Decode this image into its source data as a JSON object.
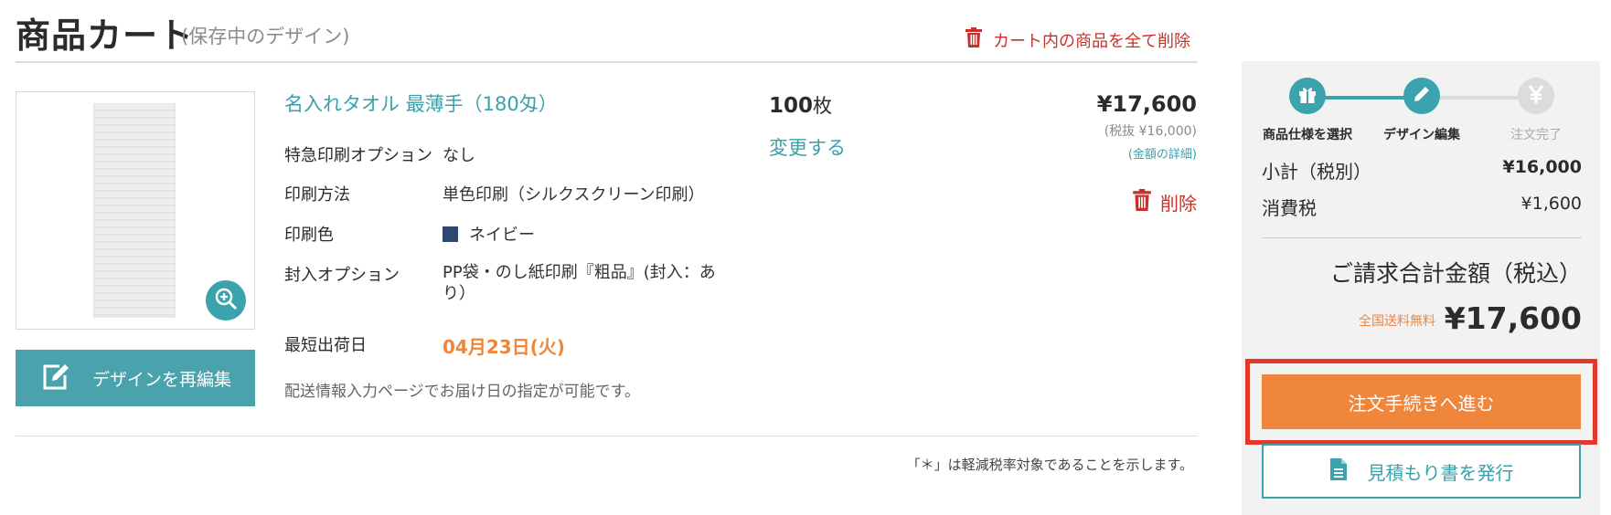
{
  "header": {
    "title": "商品カート",
    "subtitle": "(保存中のデザイン)",
    "clear_all_label": "カート内の商品を全て削除"
  },
  "item": {
    "name": "名入れタオル 最薄手（180匁）",
    "reedit_label": "デザインを再編集",
    "specs": [
      {
        "label": "特急印刷オプション",
        "value": "なし"
      },
      {
        "label": "印刷方法",
        "value": "単色印刷（シルクスクリーン印刷）"
      },
      {
        "label": "印刷色",
        "value": "ネイビー"
      },
      {
        "label": "封入オプション",
        "value": "PP袋・のし紙印刷『粗品』(封入：あり）"
      },
      {
        "label": "最短出荷日",
        "value": "04月23日(火)"
      }
    ],
    "delivery_note": "配送情報入力ページでお届け日の指定が可能です。",
    "quantity": "100",
    "quantity_unit": "枚",
    "change_label": "変更する",
    "price": "¥17,600",
    "price_pretax": "(税抜 ¥16,000)",
    "price_detail": "(金額の詳細)",
    "delete_label": "削除"
  },
  "tax_note": "「＊」は軽減税率対象であることを示します。",
  "summary": {
    "steps": [
      {
        "label": "商品仕様を選択",
        "state": "done"
      },
      {
        "label": "デザイン編集",
        "state": "current"
      },
      {
        "label": "注文完了",
        "state": "todo"
      }
    ],
    "subtotal_label": "小計（税別）",
    "subtotal_value": "¥16,000",
    "tax_label": "消費税",
    "tax_value": "¥1,600",
    "total_label": "ご請求合計金額（税込）",
    "shipping_free": "全国送料無料",
    "total_value": "¥17,600",
    "checkout_label": "注文手続きへ進む",
    "quote_label": "見積もり書を発行"
  },
  "colors": {
    "teal": "#3ba3ad",
    "orange": "#f0853c",
    "red": "#c8312b",
    "navy_swatch": "#2e4670",
    "highlight": "#e3392b"
  }
}
